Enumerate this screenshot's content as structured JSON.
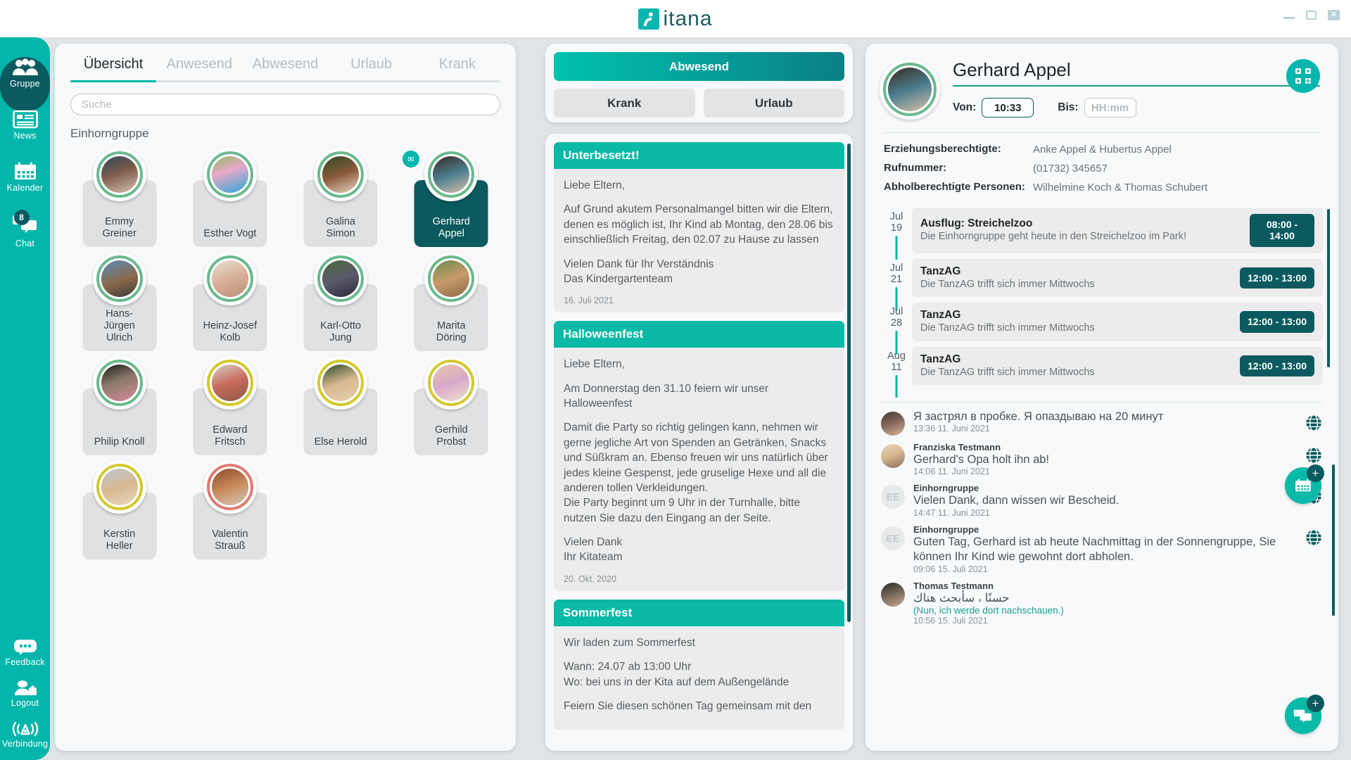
{
  "window": {
    "app_name": "itana",
    "controls": {
      "minimize": "—",
      "maximize": "❐",
      "close": "✕"
    }
  },
  "sidebar": {
    "top_items": [
      {
        "label": "Gruppe",
        "icon": "group-icon",
        "active": true
      },
      {
        "label": "News",
        "icon": "news-icon",
        "active": false
      },
      {
        "label": "Kalender",
        "icon": "calendar-icon",
        "active": false
      },
      {
        "label": "Chat",
        "icon": "chat-icon",
        "active": false,
        "badge": "8"
      }
    ],
    "bottom_items": [
      {
        "label": "Feedback",
        "icon": "feedback-icon"
      },
      {
        "label": "Logout",
        "icon": "logout-icon"
      },
      {
        "label": "Verbindung",
        "icon": "connection-icon"
      }
    ]
  },
  "left_panel": {
    "tabs": [
      {
        "label": "Übersicht",
        "active": true
      },
      {
        "label": "Anwesend",
        "active": false
      },
      {
        "label": "Abwesend",
        "active": false
      },
      {
        "label": "Urlaub",
        "active": false
      },
      {
        "label": "Krank",
        "active": false
      }
    ],
    "search": {
      "value": "",
      "placeholder": "Suche"
    },
    "group_title": "Einhorngruppe",
    "children": [
      {
        "name": "Emmy\nGreiner",
        "ring": "#6ab98e",
        "selected": false,
        "photo": "linear-gradient(160deg,#2e4a5e 0%,#7d5b4a 45%,#d8c2b0 100%)",
        "mail": false
      },
      {
        "name": "Esther Vogt",
        "ring": "#6ab98e",
        "selected": false,
        "photo": "linear-gradient(160deg,#8fb85a 0%,#e8a8c8 40%,#2aa8d8 100%)",
        "mail": false
      },
      {
        "name": "Galina\nSimon",
        "ring": "#6ab98e",
        "selected": false,
        "photo": "linear-gradient(160deg,#2d4a22 0%,#8a5a3a 50%,#e8d5c5 100%)",
        "mail": false
      },
      {
        "name": "Gerhard\nAppel",
        "ring": "#6ab98e",
        "selected": true,
        "photo": "linear-gradient(160deg,#3a2a20 0%,#4a7d8e 50%,#d8c0a8 100%)",
        "mail": true
      },
      {
        "name": "Hans-\nJürgen\nUlrich",
        "ring": "#6ab98e",
        "selected": false,
        "photo": "linear-gradient(160deg,#5a8ab8 0%,#8a6a4a 55%,#3a3a3a 100%)",
        "mail": false
      },
      {
        "name": "Heinz-Josef\nKolb",
        "ring": "#6ab98e",
        "selected": false,
        "photo": "linear-gradient(160deg,#e8e0d0 0%,#d8b098 50%,#b89078 100%)",
        "mail": false
      },
      {
        "name": "Karl-Otto\nJung",
        "ring": "#6ab98e",
        "selected": false,
        "photo": "linear-gradient(160deg,#4a6a3a 0%,#5a5a6a 50%,#2a2a3a 100%)",
        "mail": false
      },
      {
        "name": "Marita\nDöring",
        "ring": "#6ab98e",
        "selected": false,
        "photo": "linear-gradient(160deg,#6a8a4a 0%,#c89a6a 50%,#8a6a4a 100%)",
        "mail": false
      },
      {
        "name": "Philip Knoll",
        "ring": "#6ab98e",
        "selected": false,
        "photo": "linear-gradient(160deg,#1a1a1a 0%,#8a7a6a 45%,#d88a9a 100%)",
        "mail": false
      },
      {
        "name": "Edward\nFritsch",
        "ring": "#d4c82e",
        "selected": false,
        "photo": "linear-gradient(160deg,#d8d0c8 0%,#c86a5a 50%,#8a5a4a 100%)",
        "mail": false
      },
      {
        "name": "Else Herold",
        "ring": "#d4c82e",
        "selected": false,
        "photo": "linear-gradient(160deg,#2a4a2a 0%,#d8b890 50%,#e8d0b0 100%)",
        "mail": false
      },
      {
        "name": "Gerhild\nProbst",
        "ring": "#d4c82e",
        "selected": false,
        "photo": "linear-gradient(160deg,#e8c8a8 0%,#d8a8c8 50%,#f0e0d0 100%)",
        "mail": false
      },
      {
        "name": "Kerstin\nHeller",
        "ring": "#d4c82e",
        "selected": false,
        "photo": "linear-gradient(160deg,#b8c8d8 0%,#d8b890 50%,#e8d8c0 100%)",
        "mail": false
      },
      {
        "name": "Valentin\nStrauß",
        "ring": "#e07a72",
        "selected": false,
        "photo": "linear-gradient(160deg,#8a4a2a 0%,#c88a5a 50%,#d8c8b8 100%)",
        "mail": false
      }
    ]
  },
  "middle_panel": {
    "status_buttons": {
      "primary": "Abwesend",
      "secondary": [
        "Krank",
        "Urlaub"
      ]
    },
    "news": [
      {
        "title": "Unterbesetzt!",
        "paragraphs": [
          "Liebe Eltern,",
          "Auf Grund akutem Personalmangel bitten wir die Eltern, denen es möglich ist, Ihr Kind ab Montag, den 28.06 bis einschließlich Freitag, den 02.07 zu Hause zu lassen",
          "Vielen Dank für Ihr Verständnis\nDas Kindergartenteam"
        ],
        "date": "16. Juli 2021"
      },
      {
        "title": "Halloweenfest",
        "paragraphs": [
          "Liebe Eltern,",
          "Am Donnerstag den 31.10 feiern wir unser Halloweenfest",
          "Damit die Party so richtig gelingen kann, nehmen wir gerne jegliche Art von Spenden an Getränken, Snacks und Süßkram an. Ebenso freuen wir uns natürlich über jedes kleine Gespenst, jede gruselige Hexe und all die anderen tollen Verkleidungen.\nDie Party beginnt um 9 Uhr in der Turnhalle, bitte nutzen Sie dazu den Eingang an der Seite.",
          "Vielen Dank\nIhr Kitateam"
        ],
        "date": "20. Okt. 2020"
      },
      {
        "title": "Sommerfest",
        "paragraphs": [
          "Wir laden zum Sommerfest",
          "Wann: 24.07 ab 13:00 Uhr\nWo: bei uns in der Kita auf dem Außengelände",
          "Feiern Sie diesen schönen Tag gemeinsam mit den"
        ],
        "date": ""
      }
    ]
  },
  "right_panel": {
    "child": {
      "name": "Gerhard Appel",
      "von_label": "Von:",
      "von_value": "10:33",
      "bis_label": "Bis:",
      "bis_placeholder": "HH:mm",
      "qr_icon": "qr-code-icon"
    },
    "info": [
      {
        "key": "Erziehungsberechtigte:",
        "value": "Anke Appel & Hubertus Appel"
      },
      {
        "key": "Rufnummer:",
        "value": "(01732) 345657"
      },
      {
        "key": "Abholberechtigte Personen:",
        "value": "Wilhelmine Koch & Thomas Schubert"
      }
    ],
    "events": [
      {
        "month": "Jul",
        "day": "19",
        "title": "Ausflug: Streichelzoo",
        "desc": "Die Einhorngruppe geht heute in den Streichelzoo im Park!",
        "time": "08:00 -\n14:00"
      },
      {
        "month": "Jul",
        "day": "21",
        "title": "TanzAG",
        "desc": "Die TanzAG trifft sich immer Mittwochs",
        "time": "12:00 - 13:00"
      },
      {
        "month": "Jul",
        "day": "28",
        "title": "TanzAG",
        "desc": "Die TanzAG trifft sich immer Mittwochs",
        "time": "12:00 - 13:00"
      },
      {
        "month": "Aug",
        "day": "11",
        "title": "TanzAG",
        "desc": "Die TanzAG trifft sich immer Mittwochs",
        "time": "12:00 - 13:00"
      }
    ],
    "messages": [
      {
        "sender": "",
        "text": "Я застрял в пробке. Я опаздываю на 20 минут",
        "translation": "",
        "time": "13:36 11. Juni 2021",
        "avatar_initials": "",
        "photo": "linear-gradient(160deg,#3a3a3a 0%,#8a6a5a 50%,#d8b8a0 100%)",
        "has_globe": true
      },
      {
        "sender": "Franziska Testmann",
        "text": "Gerhard's Opa holt ihn ab!",
        "translation": "",
        "time": "14:06 11. Juni 2021",
        "avatar_initials": "",
        "photo": "linear-gradient(160deg,#e8d8c0 0%,#d8b890 45%,#8a7060 100%)",
        "has_globe": true
      },
      {
        "sender": "Einhorngruppe",
        "text": "Vielen Dank, dann wissen wir Bescheid.",
        "translation": "",
        "time": "14:47 11. Juni 2021",
        "avatar_initials": "EE",
        "photo": "",
        "has_globe": true
      },
      {
        "sender": "Einhorngruppe",
        "text": "Guten Tag, Gerhard ist ab heute Nachmittag in der Sonnengruppe, Sie können Ihr Kind wie gewohnt dort abholen.",
        "translation": "",
        "time": "09:06 15. Juli 2021",
        "avatar_initials": "EE",
        "photo": "",
        "has_globe": true
      },
      {
        "sender": "Thomas Testmann",
        "text": "حسنًا ، سأبحث هناك",
        "translation": "(Nun, ich werde dort nachschauen.)",
        "time": "10:56 15. Juli 2021",
        "avatar_initials": "",
        "photo": "linear-gradient(160deg,#2a2a2a 0%,#7a6a5a 50%,#c8a890 100%)",
        "has_globe": false
      }
    ],
    "fabs": [
      {
        "name": "add-calendar-event",
        "icon": "calendar-icon",
        "plus": "+"
      },
      {
        "name": "add-chat-message",
        "icon": "chat-icon",
        "plus": "+"
      }
    ]
  },
  "colors": {
    "accent_teal": "#04b6ac",
    "dark_teal": "#0b5a5f",
    "ring_green": "#6ab98e",
    "ring_yellow": "#d4c82e",
    "ring_red": "#e07a72"
  }
}
